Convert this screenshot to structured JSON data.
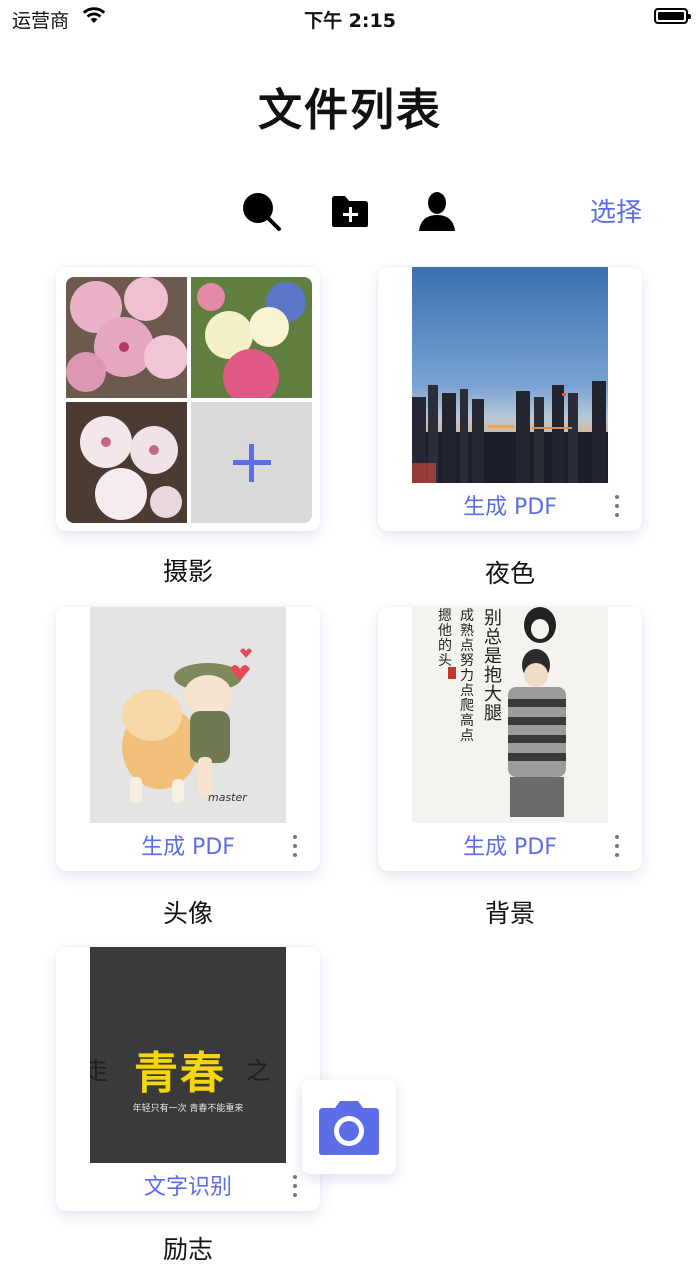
{
  "status_bar": {
    "carrier": "运营商",
    "time": "下午 2:15"
  },
  "page": {
    "title": "文件列表"
  },
  "toolbar": {
    "select_label": "选择"
  },
  "folders": [
    {
      "name": "摄影",
      "action": ""
    },
    {
      "name": "夜色",
      "action": "生成 PDF"
    },
    {
      "name": "头像",
      "action": "生成 PDF"
    },
    {
      "name": "背景",
      "action": "生成 PDF"
    },
    {
      "name": "励志",
      "action": "文字识别"
    }
  ],
  "thumb_text": {
    "youth_big": "青春",
    "youth_left": "走",
    "youth_right": "之",
    "youth_caption": "年轻只有一次 青春不能重来",
    "wallpaper_cols": [
      "别总是抱大腿",
      "成熟点努力点爬高点",
      "摁他的头"
    ],
    "sticker_signature": "master"
  },
  "colors": {
    "accent": "#5b6ee8",
    "text": "#111111"
  },
  "icons": [
    "search-icon",
    "new-folder-icon",
    "user-icon",
    "more-icon",
    "plus-icon",
    "camera-icon"
  ]
}
